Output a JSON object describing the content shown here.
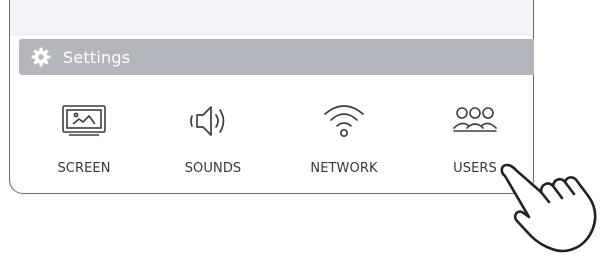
{
  "settings": {
    "title": "Settings",
    "title_icon": "gear-icon",
    "items": [
      {
        "label": "SCREEN",
        "icon": "monitor-icon"
      },
      {
        "label": "SOUNDS",
        "icon": "speaker-icon"
      },
      {
        "label": "NETWORK",
        "icon": "wifi-icon"
      },
      {
        "label": "USERS",
        "icon": "users-icon"
      }
    ]
  },
  "pointer": {
    "icon": "pointing-hand-icon"
  },
  "colors": {
    "titlebar": "#b3b7bd",
    "panel_border": "#5a6b8c",
    "icon_stroke": "#3a3f47",
    "label": "#333840"
  }
}
